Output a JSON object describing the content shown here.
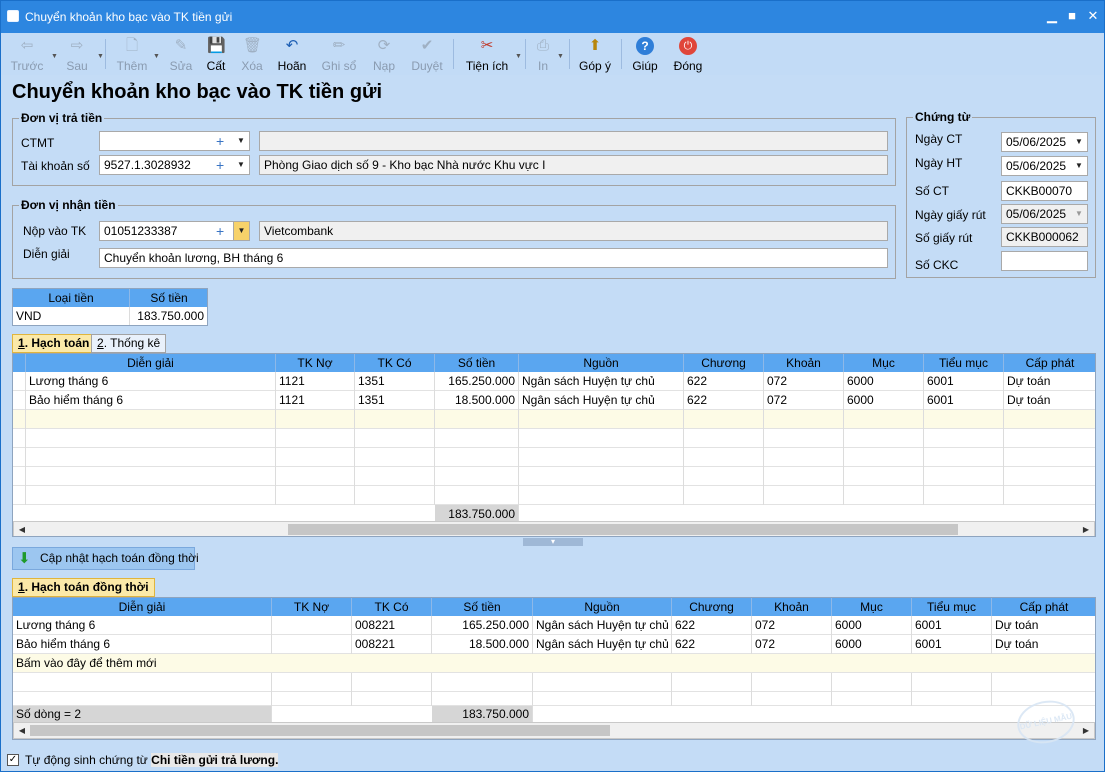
{
  "window": {
    "title": "Chuyển khoản kho bạc vào TK tiền gửi",
    "min": "▁",
    "max": "■",
    "close": "✕"
  },
  "toolbar": {
    "buttons": [
      {
        "label": "Trước",
        "icon": "⇦"
      },
      {
        "label": "Sau",
        "icon": "⇨"
      },
      {
        "label": "Thêm",
        "icon": "🗋"
      },
      {
        "label": "Sửa",
        "icon": "✎"
      },
      {
        "label": "Cất",
        "icon": "💾"
      },
      {
        "label": "Xóa",
        "icon": "🗑"
      },
      {
        "label": "Hoãn",
        "icon": "↶"
      },
      {
        "label": "Ghi sổ",
        "icon": "✏"
      },
      {
        "label": "Nạp",
        "icon": "⟳"
      },
      {
        "label": "Duyệt",
        "icon": "✔"
      },
      {
        "label": "Tiện ích",
        "icon": "✂"
      },
      {
        "label": "In",
        "icon": "⎙"
      },
      {
        "label": "Góp ý",
        "icon": "⬆"
      },
      {
        "label": "Giúp",
        "icon": "?"
      },
      {
        "label": "Đóng",
        "icon": "⏻"
      }
    ],
    "dropdown_glyph": "▼"
  },
  "heading": "Chuyển khoản kho bạc vào TK tiền gửi",
  "payer": {
    "title": "Đơn vị trả tiền",
    "ctmt_label": "CTMT",
    "ctmt_value": "",
    "ctmt_desc": "",
    "account_label": "Tài khoản số",
    "account_value": "9527.1.3028932",
    "account_desc": "Phòng Giao dịch số 9 - Kho bạc Nhà nước Khu vực I"
  },
  "payee": {
    "title": "Đơn vị nhận tiền",
    "account_label": "Nộp vào TK",
    "account_value": "01051233387",
    "bank": "Vietcombank",
    "memo_label": "Diễn giải",
    "memo_value": "Chuyển khoản lương, BH  tháng 6"
  },
  "voucher": {
    "title": "Chứng từ",
    "date_label": "Ngày CT",
    "date_value": "05/06/2025",
    "ht_label": "Ngày HT",
    "ht_value": "05/06/2025",
    "no_label": "Số CT",
    "no_value": "CKKB00070",
    "wd_date_label": "Ngày giấy rút",
    "wd_date_value": "05/06/2025",
    "wd_no_label": "Số giấy rút",
    "wd_no_value": "CKKB000062",
    "ckc_label": "Số CKC",
    "ckc_value": ""
  },
  "currency": {
    "headers": [
      "Loại tiền",
      "Số tiền"
    ],
    "code": "VND",
    "amount": "183.750.000"
  },
  "tabs1": [
    {
      "num": "1",
      "label": ". Hạch toán"
    },
    {
      "num": "2",
      "label": ". Thống kê"
    }
  ],
  "grid1": {
    "headers": [
      "Diễn giải",
      "TK Nợ",
      "TK Có",
      "Số tiền",
      "Nguồn",
      "Chương",
      "Khoản",
      "Mục",
      "Tiểu mục",
      "Cấp phát"
    ],
    "rows": [
      [
        "Lương tháng 6",
        "1121",
        "1351",
        "165.250.000",
        "Ngân sách Huyện tự chủ",
        "622",
        "072",
        "6000",
        "6001",
        "Dự toán"
      ],
      [
        "Bảo hiểm tháng 6",
        "1121",
        "1351",
        "18.500.000",
        "Ngân sách Huyện tự chủ",
        "622",
        "072",
        "6000",
        "6001",
        "Dự toán"
      ]
    ],
    "total": "183.750.000"
  },
  "update_button": "Cập nhật hạch toán đồng thời",
  "tabs2": [
    {
      "num": "1",
      "label": ". Hạch toán đồng thời"
    }
  ],
  "grid2": {
    "headers": [
      "Diễn giải",
      "TK Nợ",
      "TK Có",
      "Số tiền",
      "Nguồn",
      "Chương",
      "Khoản",
      "Mục",
      "Tiểu mục",
      "Cấp phát"
    ],
    "rows": [
      [
        "Lương tháng 6",
        "",
        "008221",
        "165.250.000",
        "Ngân sách Huyện tự chủ",
        "622",
        "072",
        "6000",
        "6001",
        "Dự toán"
      ],
      [
        "Bảo hiểm tháng 6",
        "",
        "008221",
        "18.500.000",
        "Ngân sách Huyện tự chủ",
        "622",
        "072",
        "6000",
        "6001",
        "Dự toán"
      ]
    ],
    "add_hint": "Bấm vào đây để thêm mới",
    "row_count": "Số dòng = 2",
    "total": "183.750.000"
  },
  "footer": {
    "checkbox_label": "Tự động sinh chứng từ ",
    "checkbox_bold": "Chi tiền gửi trả lương.",
    "check": "✓"
  },
  "stamp": "DỮ LIỆU MẪU",
  "glyphs": {
    "plus": "+",
    "down": "▼",
    "left": "◀",
    "right": "▶",
    "green_arrow": "⬇",
    "splitter": "▾"
  }
}
